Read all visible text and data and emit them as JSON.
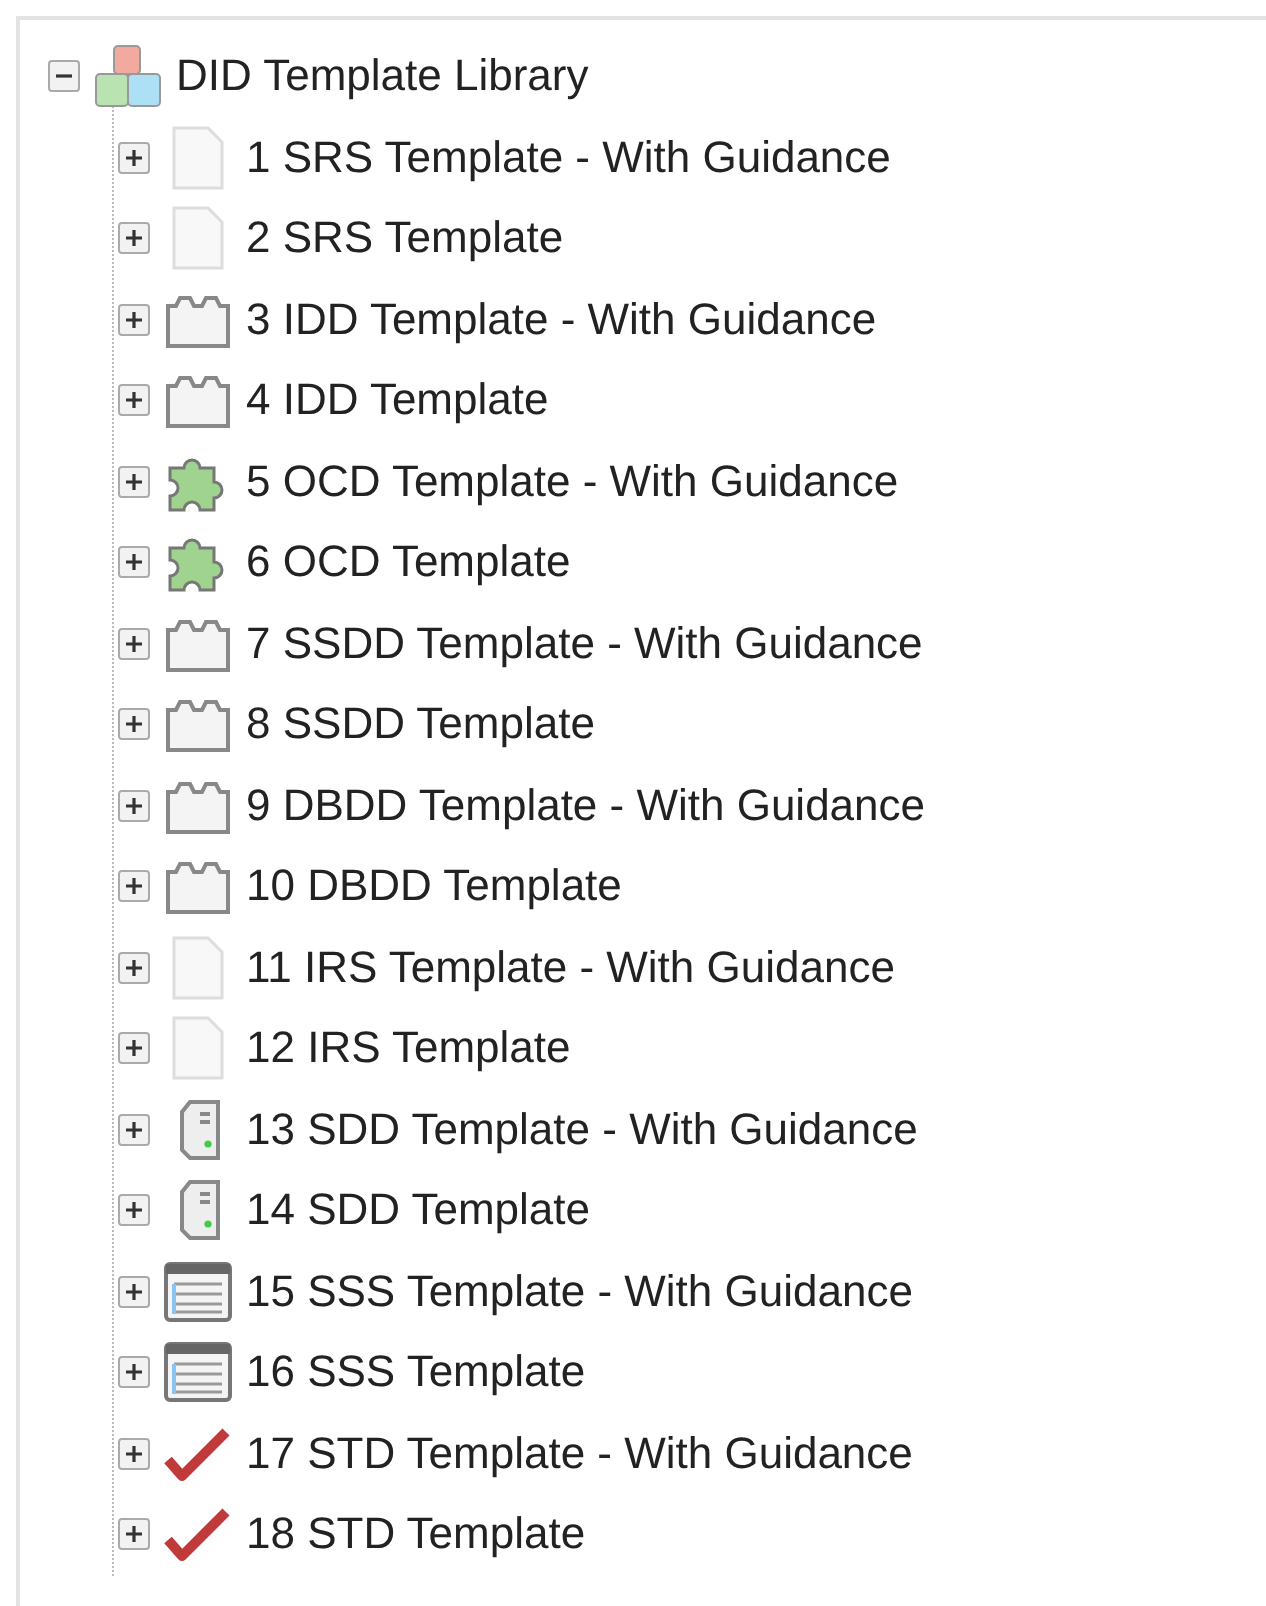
{
  "tree": {
    "label": "DID Template Library",
    "expanded": true,
    "kind": "library",
    "children": [
      {
        "label": "1 SRS Template - With Guidance",
        "expanded": false,
        "kind": "document"
      },
      {
        "label": "2 SRS Template",
        "expanded": false,
        "kind": "document"
      },
      {
        "label": "3 IDD Template - With Guidance",
        "expanded": false,
        "kind": "folder"
      },
      {
        "label": "4 IDD Template",
        "expanded": false,
        "kind": "folder"
      },
      {
        "label": "5 OCD Template - With Guidance",
        "expanded": false,
        "kind": "puzzle"
      },
      {
        "label": "6 OCD Template",
        "expanded": false,
        "kind": "puzzle"
      },
      {
        "label": "7 SSDD Template - With Guidance",
        "expanded": false,
        "kind": "folder"
      },
      {
        "label": "8 SSDD Template",
        "expanded": false,
        "kind": "folder"
      },
      {
        "label": "9 DBDD Template - With Guidance",
        "expanded": false,
        "kind": "folder"
      },
      {
        "label": "10 DBDD Template",
        "expanded": false,
        "kind": "folder"
      },
      {
        "label": "11 IRS Template - With Guidance",
        "expanded": false,
        "kind": "document"
      },
      {
        "label": "12 IRS Template",
        "expanded": false,
        "kind": "document"
      },
      {
        "label": "13 SDD Template - With Guidance",
        "expanded": false,
        "kind": "server"
      },
      {
        "label": "14 SDD Template",
        "expanded": false,
        "kind": "server"
      },
      {
        "label": "15 SSS Template - With Guidance",
        "expanded": false,
        "kind": "list"
      },
      {
        "label": "16 SSS Template",
        "expanded": false,
        "kind": "list"
      },
      {
        "label": "17 STD Template - With Guidance",
        "expanded": false,
        "kind": "check"
      },
      {
        "label": "18 STD Template",
        "expanded": false,
        "kind": "check"
      }
    ]
  }
}
